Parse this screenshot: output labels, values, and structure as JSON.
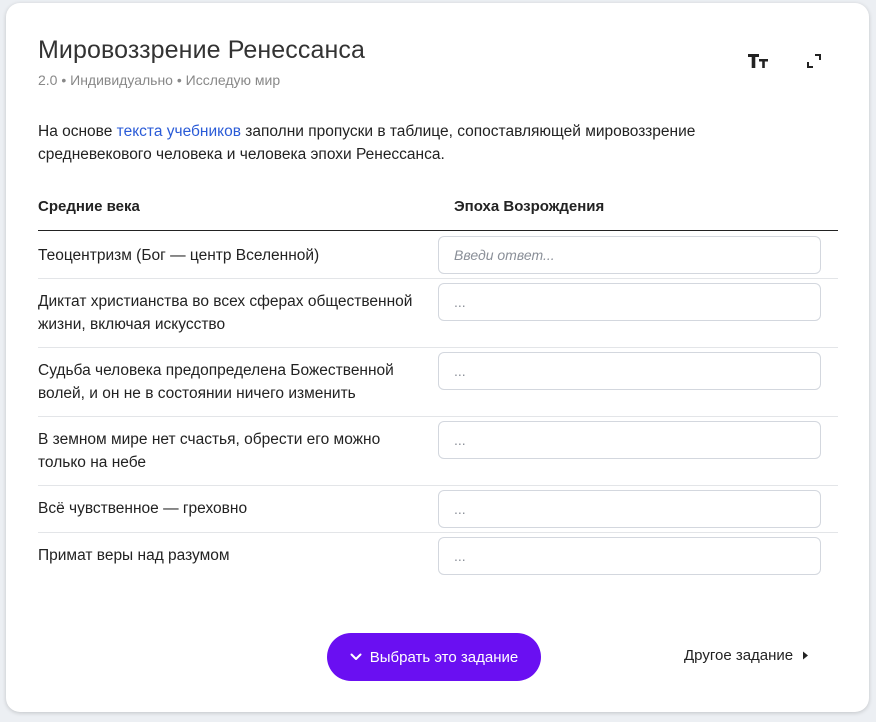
{
  "header": {
    "title": "Мировоззрение Ренессанса",
    "meta": "2.0 • Индивидуально • Исследую мир",
    "icons": [
      "text-size-icon",
      "fullscreen-icon"
    ]
  },
  "intro": {
    "before": "На основе ",
    "link": "текста учебников",
    "after": " заполни пропуски в таблице, сопоставляющей мировоззрение средневекового человека и человека эпохи Ренессанса."
  },
  "table": {
    "columns": [
      "Средние века",
      "Эпоха Возрождения"
    ],
    "rows": [
      {
        "medieval": "Теоцентризм (Бог — центр Вселенной)",
        "renaissance_value": "",
        "placeholder": "Введи ответ..."
      },
      {
        "medieval": "Диктат христианства во всех сферах общественной жизни, включая искусство",
        "renaissance_value": "",
        "placeholder": "..."
      },
      {
        "medieval": "Судьба человека предопределена Божественной волей, и он не в состоянии ничего изменить",
        "renaissance_value": "",
        "placeholder": "..."
      },
      {
        "medieval": "В земном мире нет счастья, обрести его можно только на небе",
        "renaissance_value": "",
        "placeholder": "..."
      },
      {
        "medieval": "Всё чувственное — греховно",
        "renaissance_value": "",
        "placeholder": "..."
      },
      {
        "medieval": "Примат веры над разумом",
        "renaissance_value": "",
        "placeholder": "..."
      }
    ]
  },
  "footer": {
    "primary_label": "Выбрать это задание",
    "secondary_label": "Другое задание"
  },
  "colors": {
    "accent": "#6a0ff2",
    "link": "#2a5bd7",
    "muted": "#888888",
    "border": "#d3d7de"
  }
}
